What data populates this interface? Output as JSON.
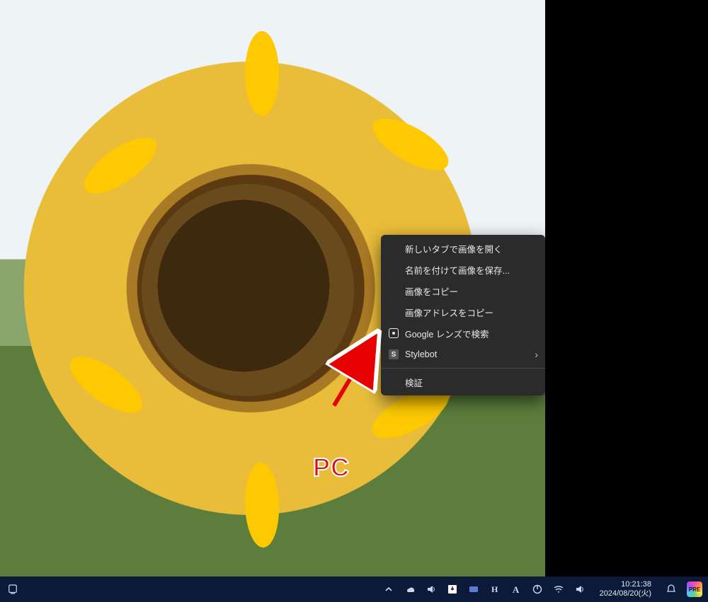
{
  "annotation": {
    "label": "PC"
  },
  "context_menu": {
    "items": [
      {
        "label": "新しいタブで画像を開く"
      },
      {
        "label": "名前を付けて画像を保存..."
      },
      {
        "label": "画像をコピー"
      },
      {
        "label": "画像アドレスをコピー"
      }
    ],
    "icon_items": [
      {
        "icon": "google-lens-icon",
        "label": "Google レンズで検索"
      },
      {
        "icon": "stylebot-icon",
        "icon_text": "S",
        "label": "Stylebot",
        "submenu": true
      }
    ],
    "inspect": {
      "label": "検証"
    }
  },
  "taskbar": {
    "time": "10:21:38",
    "date": "2024/08/20(火)",
    "pre_label": "PRE"
  }
}
